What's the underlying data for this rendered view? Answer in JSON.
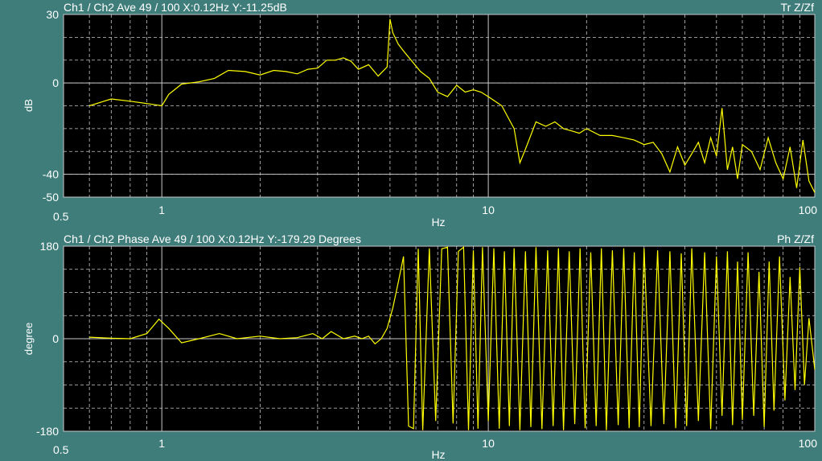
{
  "colors": {
    "background": "#3f7d7b",
    "plot_area": "#000000",
    "grid": "#c8c8c8",
    "trace": "#ffff00",
    "text": "#ffffff"
  },
  "chart_data": [
    {
      "type": "line",
      "title": "Ch1 / Ch2  Ave 49 / 100  X:0.12Hz  Y:-11.25dB",
      "right_label": "Tr Z/Zf",
      "xlabel": "Hz",
      "ylabel": "dB",
      "x_scale": "log",
      "xlim": [
        0.5,
        100
      ],
      "ylim": [
        -50,
        30
      ],
      "x_ticks": [
        {
          "value": 0.5,
          "label": "0.5"
        },
        {
          "value": 1,
          "label": "1"
        },
        {
          "value": 10,
          "label": "10"
        },
        {
          "value": 100,
          "label": "100"
        }
      ],
      "y_ticks": [
        {
          "value": 30,
          "label": "30"
        },
        {
          "value": 0,
          "label": "0"
        },
        {
          "value": -40,
          "label": "-40"
        },
        {
          "value": -50,
          "label": "-50"
        }
      ],
      "grid": true,
      "series": [
        {
          "x": [
            0.6,
            0.7,
            0.8,
            0.9,
            1.0,
            1.05,
            1.15,
            1.3,
            1.45,
            1.6,
            1.8,
            2.0,
            2.2,
            2.4,
            2.6,
            2.8,
            3.0,
            3.2,
            3.4,
            3.6,
            3.8,
            4.0,
            4.3,
            4.6,
            4.9,
            5.0,
            5.1,
            5.3,
            5.5,
            5.8,
            6.2,
            6.6,
            7.0,
            7.5,
            8.0,
            8.5,
            9.0,
            9.5,
            10,
            11,
            12,
            12.5,
            13,
            14,
            15,
            16,
            17,
            18,
            19,
            20,
            22,
            24,
            26,
            28,
            30,
            32,
            34,
            36,
            38,
            40,
            42,
            44,
            46,
            48,
            50,
            52,
            54,
            56,
            58,
            60,
            64,
            68,
            72,
            76,
            80,
            84,
            88,
            92,
            96,
            100
          ],
          "y": [
            -10,
            -7,
            -8,
            -9,
            -10,
            -5,
            -0.5,
            0.5,
            2,
            5.5,
            5,
            3.5,
            5.5,
            5,
            4,
            6,
            6.5,
            10,
            10,
            11,
            9.5,
            6,
            8,
            3,
            7,
            28,
            22,
            17,
            14,
            10,
            5,
            2,
            -4,
            -6,
            -1,
            -4,
            -3,
            -4,
            -6,
            -10,
            -20,
            -35,
            -29,
            -17,
            -19,
            -17,
            -20,
            -21,
            -22,
            -20,
            -23,
            -23,
            -24,
            -25,
            -27,
            -26,
            -31,
            -39,
            -28,
            -36,
            -31,
            -26,
            -35,
            -24,
            -32,
            -11,
            -38,
            -28,
            -42,
            -27,
            -30,
            -38,
            -24,
            -35,
            -42,
            -28,
            -46,
            -25,
            -43,
            -48
          ]
        }
      ]
    },
    {
      "type": "line",
      "title": "Ch1 / Ch2  Phase Ave 49 / 100  X:0.12Hz  Y:-179.29 Degrees",
      "right_label": "Ph Z/Zf",
      "xlabel": "Hz",
      "ylabel": "degree",
      "x_scale": "log",
      "xlim": [
        0.5,
        100
      ],
      "ylim": [
        -180,
        180
      ],
      "x_ticks": [
        {
          "value": 0.5,
          "label": "0.5"
        },
        {
          "value": 1,
          "label": "1"
        },
        {
          "value": 10,
          "label": "10"
        },
        {
          "value": 100,
          "label": "100"
        }
      ],
      "y_ticks": [
        {
          "value": 180,
          "label": "180"
        },
        {
          "value": 0,
          "label": "0"
        },
        {
          "value": -180,
          "label": "-180"
        }
      ],
      "grid": true,
      "series": [
        {
          "x": [
            0.6,
            0.7,
            0.8,
            0.9,
            0.98,
            1.05,
            1.15,
            1.3,
            1.5,
            1.7,
            2.0,
            2.3,
            2.6,
            2.9,
            3.1,
            3.3,
            3.6,
            3.9,
            4.1,
            4.3,
            4.5,
            4.7,
            4.9,
            5.1,
            5.3,
            5.5,
            5.7,
            5.9,
            6.1,
            6.3,
            6.6,
            6.9,
            7.2,
            7.5,
            7.8,
            8.1,
            8.4,
            8.7,
            9.0,
            9.3,
            9.6,
            10.0,
            10.4,
            10.8,
            11.2,
            11.6,
            12.0,
            12.5,
            13.0,
            13.5,
            14.0,
            14.6,
            15.2,
            15.8,
            16.4,
            17.0,
            17.7,
            18.4,
            19.1,
            19.8,
            20.6,
            21.4,
            22.2,
            23.0,
            24.0,
            25.0,
            26.0,
            27.0,
            28.0,
            29.0,
            30.0,
            31.5,
            33.0,
            34.5,
            36.0,
            37.5,
            39.0,
            40.5,
            42.0,
            44.0,
            46.0,
            48.0,
            50.0,
            52.0,
            54.0,
            56.0,
            58.0,
            60.0,
            62.5,
            65.0,
            67.5,
            70.0,
            72.5,
            75.0,
            78.0,
            81.0,
            84.0,
            87.0,
            90.0,
            93.0,
            96.0,
            100.0
          ],
          "y": [
            3,
            1,
            0,
            10,
            38,
            20,
            -8,
            0,
            10,
            0,
            5,
            0,
            2,
            10,
            0,
            14,
            0,
            5,
            0,
            5,
            -10,
            0,
            20,
            60,
            110,
            160,
            -170,
            -175,
            175,
            -178,
            176,
            -160,
            175,
            178,
            -165,
            170,
            178,
            -178,
            172,
            -175,
            178,
            -160,
            176,
            -175,
            170,
            -170,
            176,
            -178,
            170,
            -172,
            178,
            -176,
            172,
            -170,
            176,
            -178,
            170,
            -166,
            176,
            -174,
            168,
            -170,
            176,
            -178,
            172,
            -168,
            176,
            -174,
            168,
            -172,
            176,
            -170,
            172,
            -166,
            170,
            -174,
            166,
            -170,
            176,
            -160,
            168,
            -176,
            160,
            -150,
            170,
            -168,
            150,
            -158,
            168,
            -150,
            130,
            -172,
            150,
            -140,
            160,
            -120,
            120,
            -100,
            140,
            -90,
            40,
            -60
          ]
        }
      ]
    }
  ]
}
